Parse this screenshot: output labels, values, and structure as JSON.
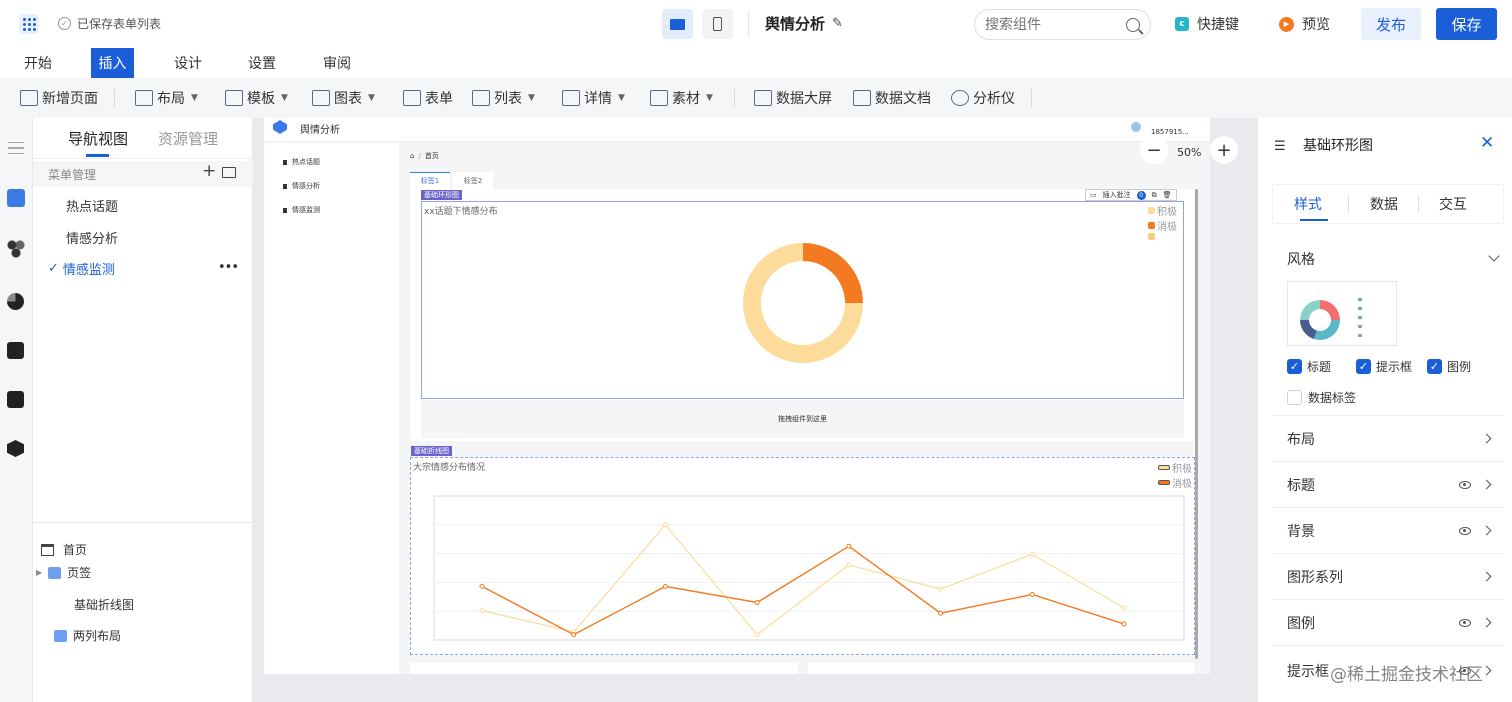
{
  "topbar": {
    "saved_label": "已保存表单列表",
    "app_title": "舆情分析",
    "search_placeholder": "搜索组件",
    "shortcut_label": "快捷键",
    "preview_label": "预览",
    "publish_label": "发布",
    "save_label": "保存"
  },
  "menu": {
    "tabs": [
      "开始",
      "插入",
      "设计",
      "设置",
      "审阅"
    ],
    "active": "插入"
  },
  "toolbar": {
    "new_page": "新增页面",
    "layout": "布局",
    "template": "模板",
    "chart": "图表",
    "form": "表单",
    "list": "列表",
    "detail": "详情",
    "material": "素材",
    "big_screen": "数据大屏",
    "data_doc": "数据文档",
    "analyzer": "分析仪"
  },
  "left_panel": {
    "tabs": [
      "导航视图",
      "资源管理"
    ],
    "menu_header": "菜单管理",
    "menu_items": [
      "热点话题",
      "情感分析",
      "情感监测"
    ],
    "active_item": "情感监测",
    "tree": {
      "home": "首页",
      "tabs": "页签",
      "line_chart": "基础折线图",
      "two_col": "两列布局"
    }
  },
  "canvas": {
    "app_name": "舆情分析",
    "user": "1857915...",
    "nav_items": [
      "热点话题",
      "情感分析",
      "情感监测"
    ],
    "breadcrumb": "首页",
    "tabs": [
      "标签1",
      "标签2"
    ],
    "zoom": "50%",
    "donut_tag": "基础环形图",
    "donut_actions": {
      "annotate": "插入批注",
      "count": "0"
    },
    "donut_title": "xx话题下情感分布",
    "donut_legend": [
      "积极",
      "消极",
      ""
    ],
    "drop_hint": "拖拽组件到这里",
    "line_tag": "基础折线图",
    "line_title": "大宗情感分布情况",
    "line_legend": [
      "积极",
      "消极"
    ]
  },
  "right_panel": {
    "title": "基础环形图",
    "tabs": [
      "样式",
      "数据",
      "交互"
    ],
    "active_tab": "样式",
    "style_section": "风格",
    "checks": [
      {
        "label": "标题",
        "checked": true
      },
      {
        "label": "提示框",
        "checked": true
      },
      {
        "label": "图例",
        "checked": true
      },
      {
        "label": "数据标签",
        "checked": false
      }
    ],
    "sections": [
      "布局",
      "标题",
      "背景",
      "图形系列",
      "图例",
      "提示框"
    ],
    "watermark": "@稀土掘金技术社区"
  },
  "colors": {
    "primary": "#1a5fd8",
    "orange": "#f47a22",
    "light_orange": "#fddc9b",
    "tag": "#6c63c9"
  },
  "chart_data": [
    {
      "type": "pie",
      "title": "xx话题下情感分布",
      "labels": [
        "积极",
        "消极"
      ],
      "values": [
        75,
        25
      ],
      "colors": [
        "#fddc9b",
        "#f47a22"
      ],
      "legend": "top-right"
    },
    {
      "type": "line",
      "title": "大宗情感分布情况",
      "x": [
        1,
        2,
        3,
        4,
        5,
        6,
        7,
        8
      ],
      "ylim": [
        0,
        5
      ],
      "series": [
        {
          "name": "积极",
          "values": [
            1.1,
            0.3,
            4.3,
            0.2,
            2.8,
            1.9,
            3.2,
            1.2
          ],
          "color": "#fddc9b"
        },
        {
          "name": "消极",
          "values": [
            2.0,
            0.2,
            2.0,
            1.4,
            3.5,
            1.0,
            1.7,
            0.6
          ],
          "color": "#f47a22"
        }
      ],
      "legend": "top-right",
      "grid": true
    }
  ]
}
